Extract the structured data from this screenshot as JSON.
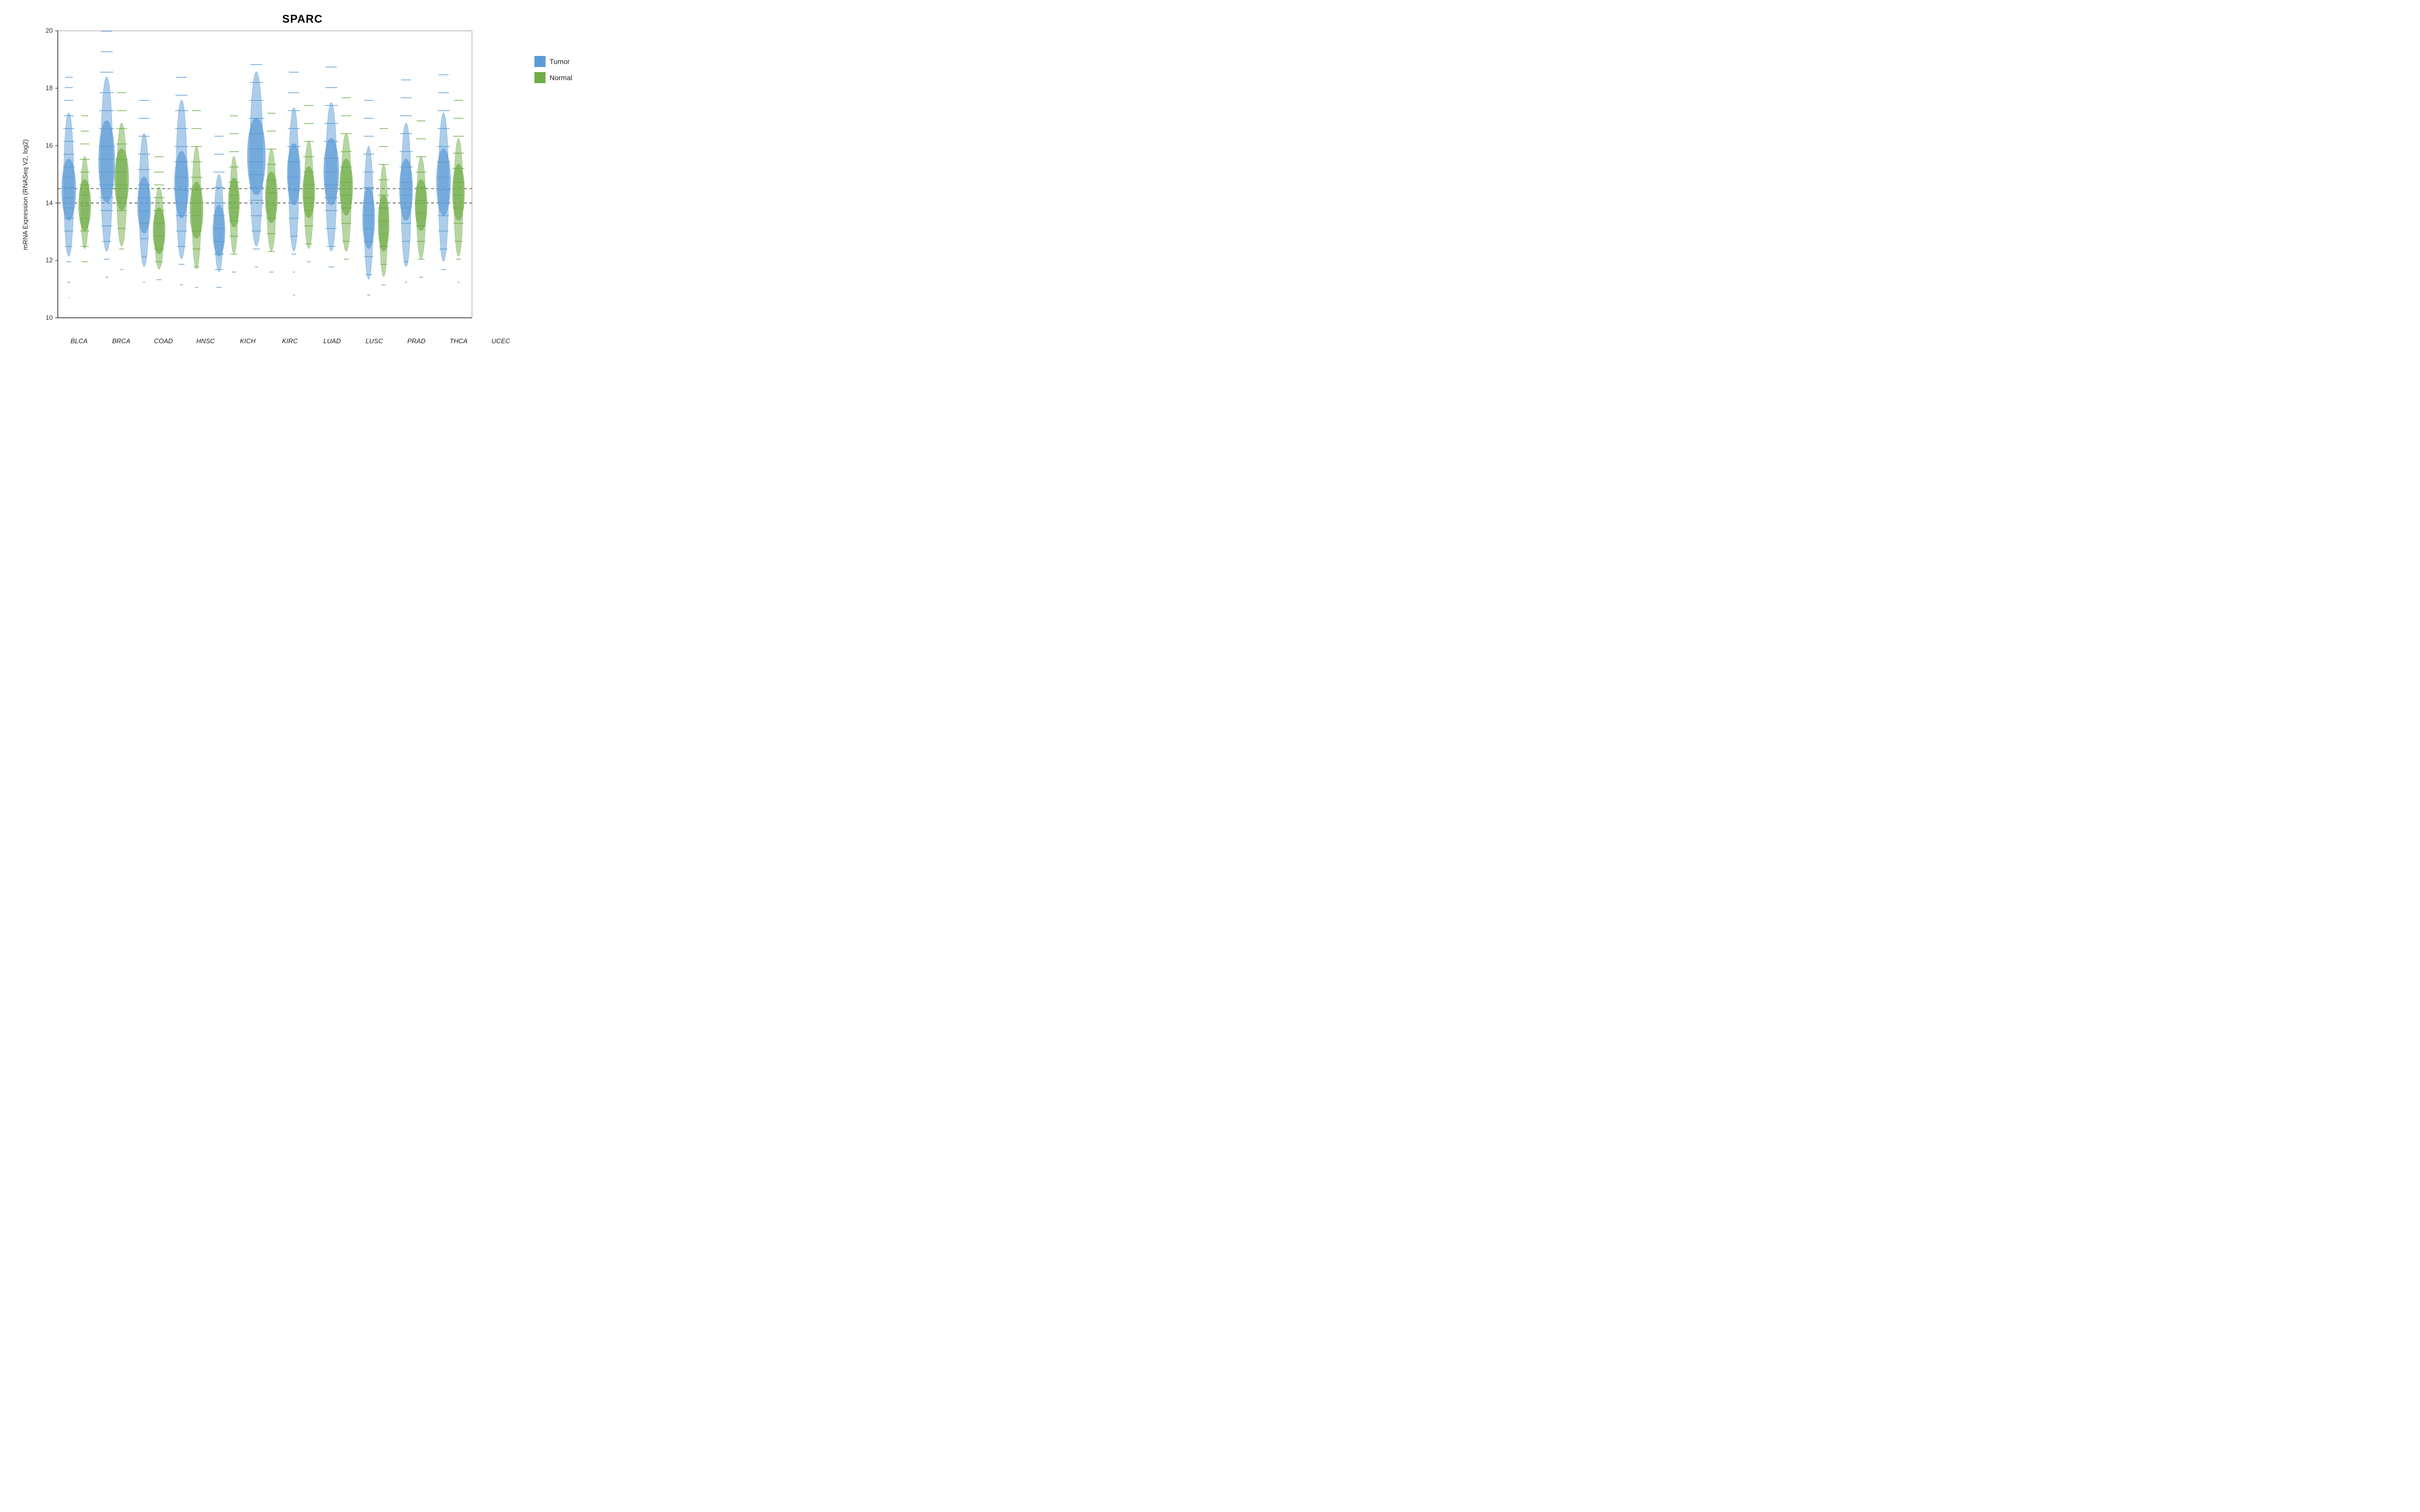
{
  "title": "SPARC",
  "yAxisLabel": "mRNA Expression (RNASeq V2, log2)",
  "xLabels": [
    "BLCA",
    "BRCA",
    "COAD",
    "HNSC",
    "KICH",
    "KIRC",
    "LUAD",
    "LUSC",
    "PRAD",
    "THCA",
    "UCEC"
  ],
  "legend": {
    "items": [
      {
        "label": "Tumor",
        "color": "#4472C4"
      },
      {
        "label": "Normal",
        "color": "#548235"
      }
    ]
  },
  "yAxis": {
    "min": 10,
    "max": 20,
    "ticks": [
      10,
      12,
      14,
      16,
      18,
      20
    ]
  },
  "colors": {
    "tumor": "#5B9BD5",
    "normal": "#70AD47",
    "axis": "#333",
    "dottedLine": "#555"
  }
}
